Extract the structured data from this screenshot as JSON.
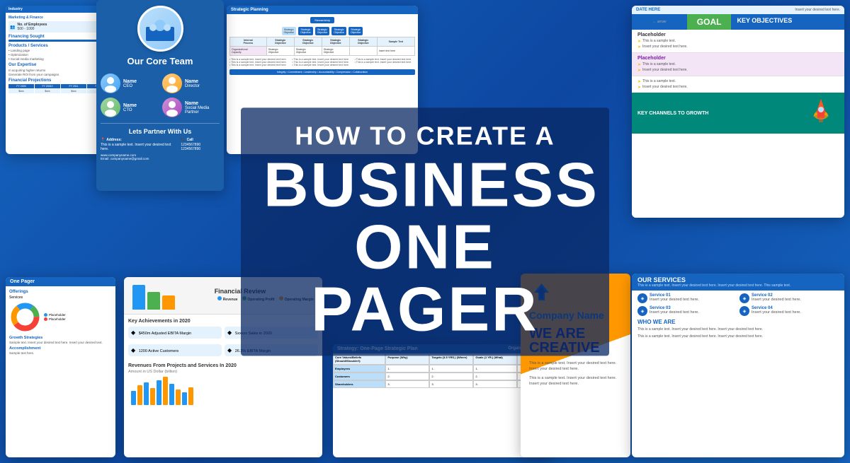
{
  "background_color": "#1565c0",
  "main_title": {
    "how_to": "HOW TO CREATE A",
    "business": "BUSINESS",
    "one_pager": "ONE PAGER"
  },
  "cards": {
    "core_team": {
      "title": "Our Core Team",
      "members": [
        {
          "name": "Name",
          "role": "CEO"
        },
        {
          "name": "Name",
          "role": "Director"
        },
        {
          "name": "Name",
          "role": "CTO"
        },
        {
          "name": "Name",
          "role": "Social Media Partner"
        }
      ],
      "partner_title": "Lets Partner With Us",
      "address_label": "Address:",
      "address_text": "This is a sample text. Insert your desired text here.",
      "call_label": "Call",
      "call_text": "1234567890 1234567890",
      "website": "www.companyname.com",
      "email": "Email: companyname@gmail.com"
    },
    "strategic": {
      "title": "Strategic Planning",
      "org_chart": {
        "stewardship": "Stewardship",
        "levels": [
          [
            "Internal Process",
            "Strategic Objective",
            "Strategic Objective",
            "Strategic Objective",
            "Strategic Objective"
          ],
          [
            "Organizational Capacity",
            "Strategic Objective",
            "Strategic Objective",
            "Strategic Objective",
            ""
          ]
        ],
        "values": "Integrity • Commitment • Leadership • Accountability • Compression • Collaboration"
      }
    },
    "goal_objectives": {
      "date_label": "DATE HERE",
      "date_placeholder": "Insert your desired text here.",
      "goal": "GOAL",
      "key_objectives": "KEY OBJECTIVES",
      "placeholder1": "Placeholder",
      "sample_text": "This is a sample text.",
      "insert_text": "Insert your desired text here.",
      "placeholder2": "Placeholder",
      "key_channels": "KEY CHANNELS TO GROWTH"
    },
    "financial_review": {
      "title": "Financial Review",
      "chart_labels": [
        "Revenue",
        "Operating Profit",
        "Operating Margin"
      ],
      "key_achievements": "Key Achievements in 2020",
      "achievements": [
        {
          "icon": "◆",
          "text": "$450m Adjusted EBITA Margin"
        },
        {
          "icon": "◆",
          "text": "Sxxxxx Sales in 2020"
        },
        {
          "icon": "◆",
          "text": "1200 Active Customers"
        },
        {
          "icon": "◆",
          "text": "26.3% EBITA Margin"
        }
      ],
      "revenues_title": "Revenues From Projects and Services In 2020",
      "revenues_subtitle": "Amount in US Dollar (billion)"
    },
    "strat_plan": {
      "title": "Strategy: One-Page Strategic Plan",
      "org_name_label": "Organization Name:",
      "columns": [
        "Core Values/Beliefs (Should/Shouldn't)",
        "Purpose (Why)",
        "Targets (3-5 YRS.) (Where)",
        "Goals (1 YR.) (What)",
        ""
      ],
      "row_labels": [
        "Employees",
        "Customers",
        "Shareholders"
      ]
    },
    "company": {
      "logo_icon": "M",
      "company_name": "Company Name",
      "we_are": "WE ARE",
      "creative": "CREATIVE",
      "desc": "This is a sample text. Insert your desired text here. Insert your desired text here.",
      "desc2": "This is a sample text. Insert your desired text here. Insert your desired text here.",
      "our_services": "OUR SERVICES",
      "services_text": "This is a sample text. Insert your desired text here. Insert your desired text here. This sample text.",
      "who_we_are": "WHO WE ARE",
      "services": [
        {
          "label": "Service 01",
          "text": "Insert your desired text here."
        },
        {
          "label": "Service 02",
          "text": "Insert your desired text here."
        },
        {
          "label": "Service 03",
          "text": "Insert your desired text here."
        },
        {
          "label": "Service 04",
          "text": "Insert your desired text here."
        }
      ]
    },
    "left_slide": {
      "industry": "Industry",
      "marketing": "Marketing & Finance",
      "employees_label": "No. of Employees",
      "employees_range": "500 - 1000",
      "financing": "Financing Sought",
      "products_services": "Products / Services",
      "expertise": "Our Expertise",
      "financial_proj": "Financial Projections",
      "years": [
        "FY 2009",
        "FY 20010",
        "FY 2011",
        "FY 2012"
      ]
    }
  },
  "colors": {
    "primary_blue": "#1565c0",
    "dark_blue": "#0d47a1",
    "orange": "#ff9800",
    "green": "#4caf50",
    "purple": "#7b1fa2",
    "teal": "#00897b",
    "gold": "#ffc107"
  }
}
